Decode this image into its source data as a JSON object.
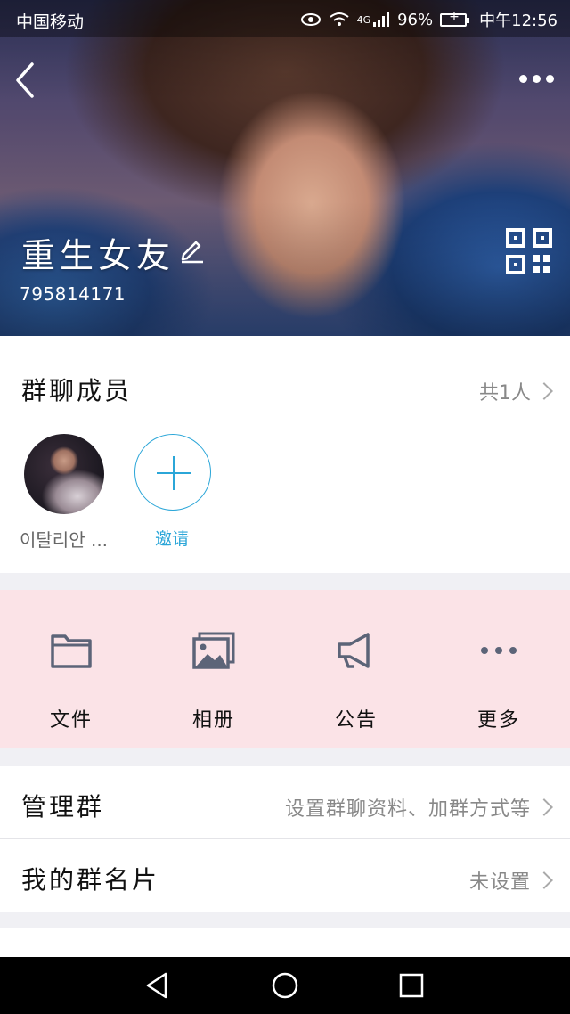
{
  "status_bar": {
    "carrier": "中国移动",
    "network": "4G",
    "battery": "96%",
    "time": "中午12:56"
  },
  "header": {
    "group_name": "重生女友",
    "group_id": "795814171"
  },
  "members": {
    "title": "群聊成员",
    "count_label": "共1人",
    "list": [
      {
        "name": "이탈리안 ..."
      }
    ],
    "invite_label": "邀请"
  },
  "features": [
    {
      "label": "文件",
      "icon": "folder-icon"
    },
    {
      "label": "相册",
      "icon": "album-icon"
    },
    {
      "label": "公告",
      "icon": "megaphone-icon"
    },
    {
      "label": "更多",
      "icon": "more-dots-icon"
    }
  ],
  "rows": [
    {
      "title": "管理群",
      "value": "设置群聊资料、加群方式等"
    },
    {
      "title": "我的群名片",
      "value": "未设置"
    }
  ],
  "colors": {
    "accent": "#2ba6d8",
    "feature_bg": "#fbe3e7",
    "icon_gray": "#5c6478"
  }
}
